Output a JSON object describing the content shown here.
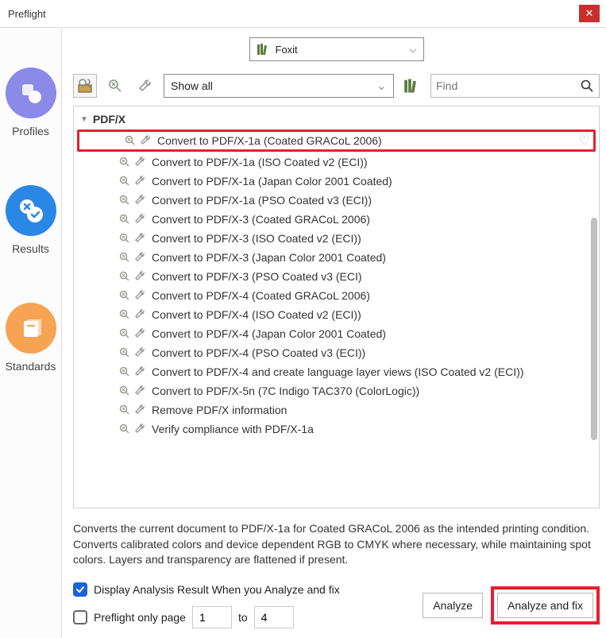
{
  "window": {
    "title": "Preflight"
  },
  "sidebar": {
    "items": [
      {
        "label": "Profiles",
        "icon": "profiles"
      },
      {
        "label": "Results",
        "icon": "results"
      },
      {
        "label": "Standards",
        "icon": "standards"
      }
    ]
  },
  "toolbar": {
    "library_selected": "Foxit",
    "filter_selected": "Show all",
    "search_placeholder": "Find"
  },
  "tree": {
    "group": "PDF/X",
    "selected_index": 0,
    "items": [
      "Convert to PDF/X-1a (Coated GRACoL 2006)",
      "Convert to PDF/X-1a (ISO Coated v2 (ECI))",
      "Convert to PDF/X-1a (Japan Color 2001 Coated)",
      "Convert to PDF/X-1a (PSO Coated v3 (ECI))",
      "Convert to PDF/X-3 (Coated GRACoL 2006)",
      "Convert to PDF/X-3 (ISO Coated v2 (ECI))",
      "Convert to PDF/X-3 (Japan Color 2001 Coated)",
      "Convert to PDF/X-3 (PSO Coated v3 (ECI)",
      "Convert to PDF/X-4 (Coated GRACoL 2006)",
      "Convert to PDF/X-4 (ISO Coated v2 (ECI))",
      "Convert to PDF/X-4 (Japan Color 2001 Coated)",
      "Convert to PDF/X-4 (PSO Coated v3 (ECI))",
      "Convert to PDF/X-4 and create language layer views (ISO Coated v2 (ECI))",
      "Convert to PDF/X-5n (7C Indigo TAC370 (ColorLogic))",
      "Remove PDF/X information",
      "Verify compliance with PDF/X-1a"
    ]
  },
  "description": "Converts the current document to PDF/X-1a for Coated GRACoL 2006 as the intended printing condition. Converts calibrated colors and device dependent RGB to CMYK where necessary, while maintaining spot colors. Layers and transparency are flattened if present.",
  "options": {
    "display_result_label": "Display Analysis Result When you Analyze and fix",
    "display_result_checked": true,
    "preflight_only_label": "Preflight only page",
    "preflight_only_checked": false,
    "page_from": "1",
    "page_to_label": "to",
    "page_to": "4"
  },
  "buttons": {
    "analyze": "Analyze",
    "analyze_fix": "Analyze and fix"
  },
  "colors": {
    "highlight": "#ea1d2d",
    "accent_blue": "#1a63d9"
  }
}
